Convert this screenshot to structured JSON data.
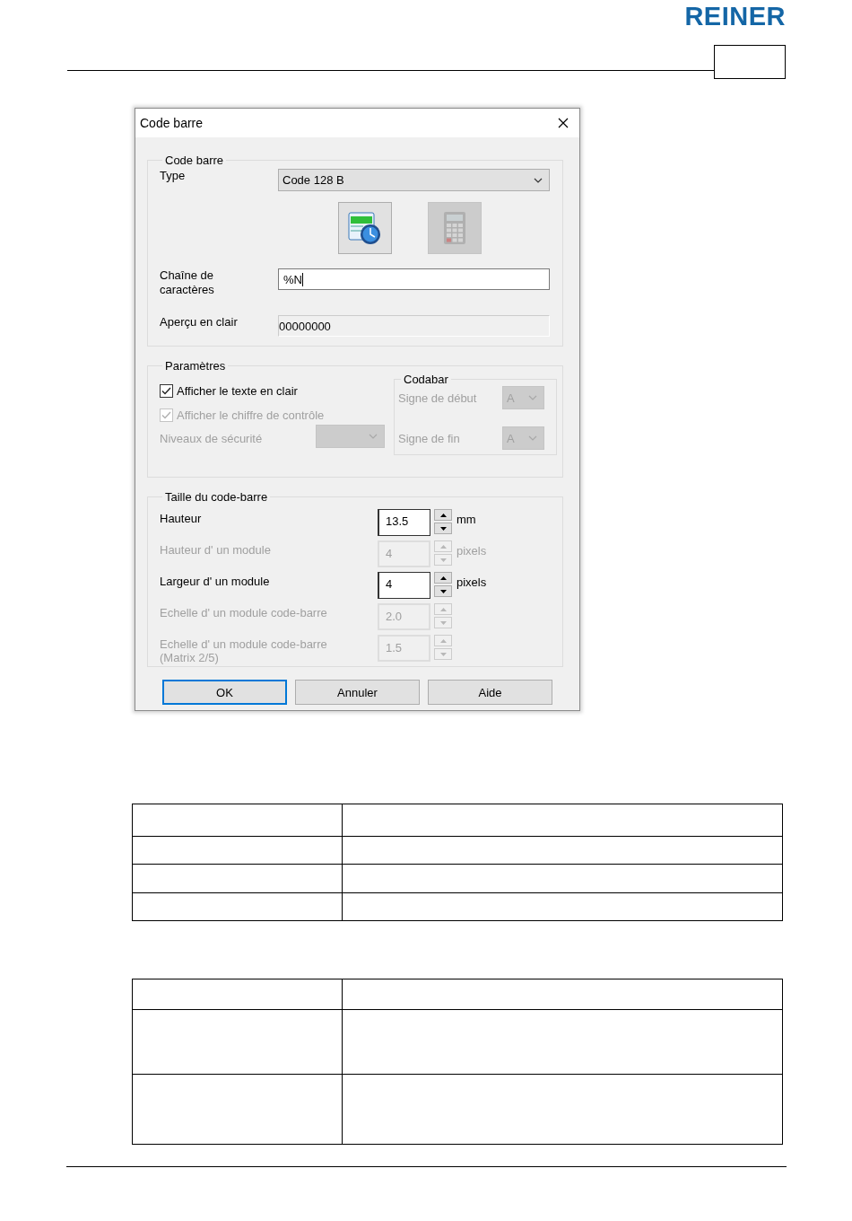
{
  "header": {
    "logo": "REINER"
  },
  "dialog": {
    "title": "Code barre",
    "barcode": {
      "title": "Code barre",
      "type_label": "Type",
      "type_value": "Code 128 B",
      "string_label": "Chaîne de caractères",
      "string_value": "%N",
      "preview_label": "Aperçu en clair",
      "preview_value": "00000000"
    },
    "image_buttons": [
      {
        "kind": "clock",
        "disabled": false
      },
      {
        "kind": "calculator",
        "disabled": true
      }
    ],
    "parameters": {
      "title": "Paramètres",
      "checkboxes": [
        {
          "label": "Afficher le texte en clair",
          "checked": true,
          "disabled": false
        },
        {
          "label": "Afficher le chiffre de contrôle",
          "checked": true,
          "disabled": true
        }
      ],
      "security": {
        "label": "Niveaux de sécurité",
        "disabled": true
      },
      "codabar": {
        "title": "Codabar",
        "rows": [
          {
            "label": "Signe de début",
            "value": "A",
            "disabled": true
          },
          {
            "label": "Signe de fin",
            "value": "A",
            "disabled": true
          }
        ]
      }
    },
    "size": {
      "title": "Taille du code-barre",
      "rows": [
        {
          "label": "Hauteur",
          "value": "13.5",
          "unit": "mm",
          "disabled": false
        },
        {
          "label": "Hauteur d' un module",
          "value": "4",
          "unit": "pixels",
          "disabled": true
        },
        {
          "label": "Largeur d' un module",
          "value": "4",
          "unit": "pixels",
          "disabled": false
        },
        {
          "label": "Echelle d' un module code-barre",
          "value": "2.0",
          "disabled": true
        },
        {
          "label": "Echelle d' un module code-barre (Matrix 2/5)",
          "value": "1.5",
          "disabled": true
        }
      ]
    },
    "buttons": [
      {
        "label": "OK",
        "focused": true
      },
      {
        "label": "Annuler",
        "focused": false
      },
      {
        "label": "Aide",
        "focused": false
      }
    ]
  }
}
